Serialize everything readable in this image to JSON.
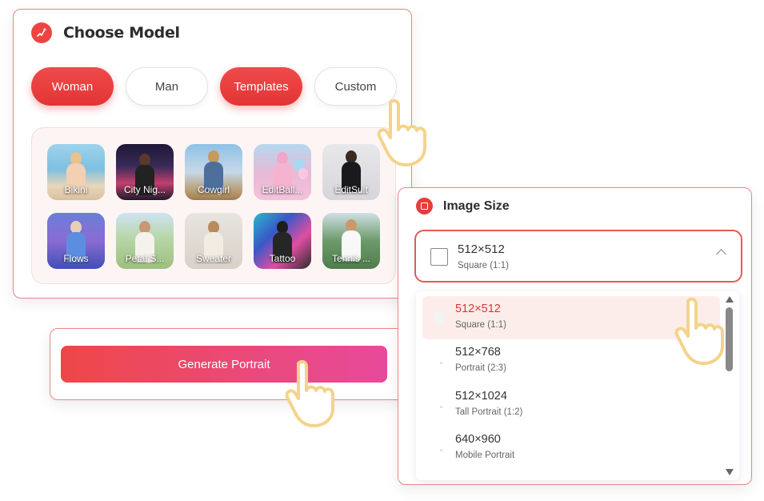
{
  "choose_model": {
    "title": "Choose Model",
    "tabs": [
      {
        "label": "Woman",
        "active": true
      },
      {
        "label": "Man",
        "active": false
      },
      {
        "label": "Templates",
        "active": true
      },
      {
        "label": "Custom",
        "active": false
      }
    ],
    "templates": [
      {
        "label": "Bikini"
      },
      {
        "label": "City Nig..."
      },
      {
        "label": "Cowgirl"
      },
      {
        "label": "EditBall..."
      },
      {
        "label": "EditSuit"
      },
      {
        "label": "Flows"
      },
      {
        "label": "Petal S..."
      },
      {
        "label": "Sweater"
      },
      {
        "label": "Tattoo"
      },
      {
        "label": "Tennis ..."
      }
    ]
  },
  "generate": {
    "button_label": "Generate Portrait"
  },
  "image_size": {
    "title": "Image Size",
    "selected": {
      "size": "512×512",
      "ratio": "Square (1:1)"
    },
    "options": [
      {
        "size": "512×512",
        "ratio": "Square (1:1)",
        "selected": true
      },
      {
        "size": "512×768",
        "ratio": "Portrait (2:3)",
        "selected": false
      },
      {
        "size": "512×1024",
        "ratio": "Tall Portrait (1:2)",
        "selected": false
      },
      {
        "size": "640×960",
        "ratio": "Mobile Portrait",
        "selected": false
      }
    ]
  },
  "colors": {
    "accent": "#e23535",
    "gradient_end": "#e84a9c",
    "panel_border": "#e98686"
  },
  "icons": [
    "sparkle-icon",
    "square-icon",
    "chevron-up-icon",
    "hand-pointer-icon"
  ]
}
